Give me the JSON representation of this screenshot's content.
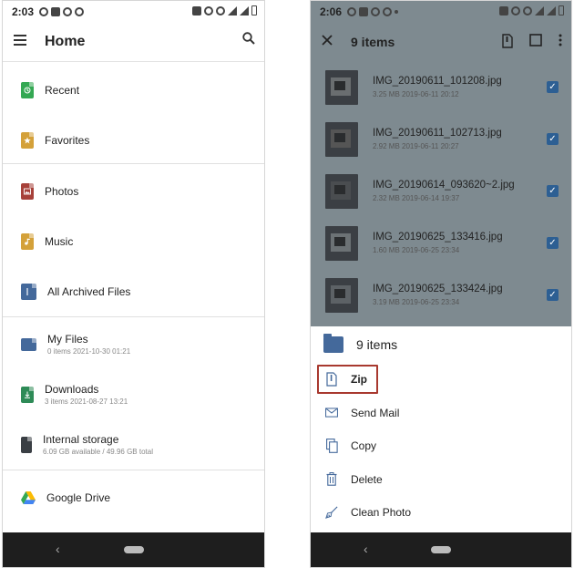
{
  "left": {
    "status": {
      "time": "2:03"
    },
    "appbar": {
      "title": "Home",
      "menu_icon": "hamburger-icon",
      "search_icon": "search-icon"
    },
    "sections": [
      [
        {
          "label": "Recent",
          "icon": "recent-icon",
          "color": "#34a853"
        },
        {
          "label": "Favorites",
          "icon": "star-icon",
          "color": "#d4a13a"
        }
      ],
      [
        {
          "label": "Photos",
          "icon": "photo-icon",
          "color": "#a7413a"
        },
        {
          "label": "Music",
          "icon": "music-icon",
          "color": "#d4a13a"
        },
        {
          "label": "All Archived Files",
          "icon": "archive-icon",
          "color": "#44699b"
        }
      ],
      [
        {
          "label": "My Files",
          "sub": "0 items 2021-10-30 01:21",
          "icon": "folder-icon",
          "color": "#44699b"
        },
        {
          "label": "Downloads",
          "sub": "3 items 2021-08-27 13:21",
          "icon": "download-icon",
          "color": "#2e8b57"
        },
        {
          "label": "Internal storage",
          "sub": "6.09 GB available / 49.96 GB total",
          "icon": "sd-card-icon",
          "color": "#3a3f44"
        }
      ],
      [
        {
          "label": "Google Drive",
          "icon": "google-drive-icon",
          "color": "#34a853"
        }
      ]
    ]
  },
  "right": {
    "status": {
      "time": "2:06"
    },
    "appbar": {
      "title": "9 items"
    },
    "files": [
      {
        "name": "IMG_20190611_101208.jpg",
        "meta": "3.25 MB 2019-06-11 20:12"
      },
      {
        "name": "IMG_20190611_102713.jpg",
        "meta": "2.92 MB 2019-06-11 20:27"
      },
      {
        "name": "IMG_20190614_093620~2.jpg",
        "meta": "2.32 MB 2019-06-14 19:37"
      },
      {
        "name": "IMG_20190625_133416.jpg",
        "meta": "1.60 MB 2019-06-25 23:34"
      },
      {
        "name": "IMG_20190625_133424.jpg",
        "meta": "3.19 MB 2019-06-25 23:34"
      }
    ],
    "sheet": {
      "title": "9 items",
      "actions": [
        {
          "label": "Zip",
          "icon": "zip-icon"
        },
        {
          "label": "Send Mail",
          "icon": "mail-icon"
        },
        {
          "label": "Copy",
          "icon": "copy-icon"
        },
        {
          "label": "Delete",
          "icon": "trash-icon"
        },
        {
          "label": "Clean Photo",
          "icon": "broom-icon"
        }
      ]
    }
  },
  "colors": {
    "accent": "#44699b",
    "highlight": "#a8392f",
    "check": "#2d5f93"
  }
}
